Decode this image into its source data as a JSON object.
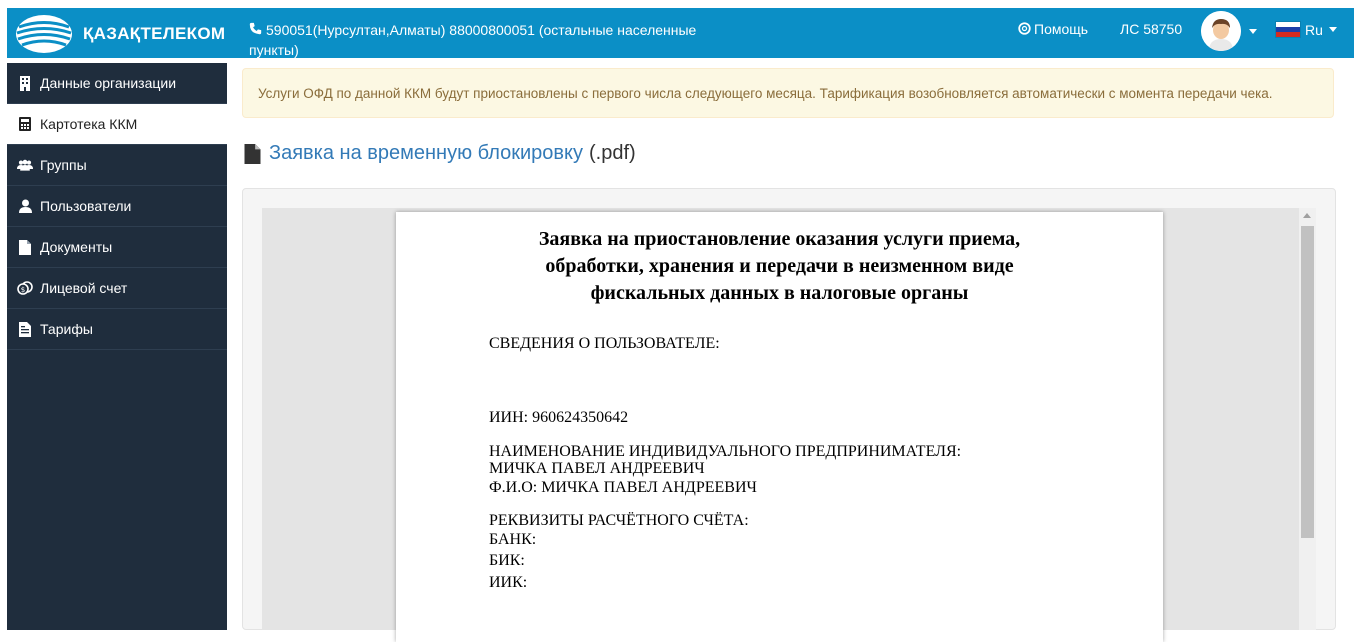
{
  "header": {
    "brand": "ҚАЗАҚТЕЛЕКОМ",
    "phone_line1": "590051(Нурсултан,Алматы) 88000800051 (остальные населенные",
    "phone_line2": "пункты)",
    "help_label": "Помощь",
    "account_label": "ЛС 58750",
    "language": "Ru",
    "bg_color": "#0b8fc6"
  },
  "sidebar": {
    "items": [
      {
        "label": "Данные организации",
        "icon": "building-icon"
      },
      {
        "label": "Картотека ККМ",
        "icon": "calculator-icon",
        "active": true
      },
      {
        "label": "Группы",
        "icon": "users-icon"
      },
      {
        "label": "Пользователи",
        "icon": "user-icon"
      },
      {
        "label": "Документы",
        "icon": "file-icon"
      },
      {
        "label": "Лицевой счет",
        "icon": "coins-icon"
      },
      {
        "label": "Тарифы",
        "icon": "file-text-icon"
      }
    ]
  },
  "alert": {
    "text": "Услуги ОФД по данной ККМ будут приостановлены с первого числа следующего месяца. Тарификация возобновляется автоматически с момента передачи чека."
  },
  "document": {
    "link_text": "Заявка на временную блокировку",
    "extension": "(.pdf)"
  },
  "pdf": {
    "title_lines": [
      "Заявка на приостановление  оказания услуги приема,",
      "обработки, хранения и передачи в неизменном виде",
      "фискальных данных в налоговые органы"
    ],
    "user_info_heading": "СВЕДЕНИЯ О ПОЛЬЗОВАТЕЛЕ:",
    "iin": "ИИН: 960624350642",
    "entrepreneur_heading": "НАИМЕНОВАНИЕ ИНДИВИДУАЛЬНОГО ПРЕДПРИНИМАТЕЛЯ:",
    "entrepreneur_name": "МИЧКА ПАВЕЛ АНДРЕЕВИЧ",
    "fio": "Ф.И.О: МИЧКА ПАВЕЛ АНДРЕЕВИЧ",
    "account_heading": "РЕКВИЗИТЫ РАСЧЁТНОГО СЧЁТА:",
    "bank": "БАНК:",
    "bik": "БИК:",
    "iik": "ИИК:"
  }
}
